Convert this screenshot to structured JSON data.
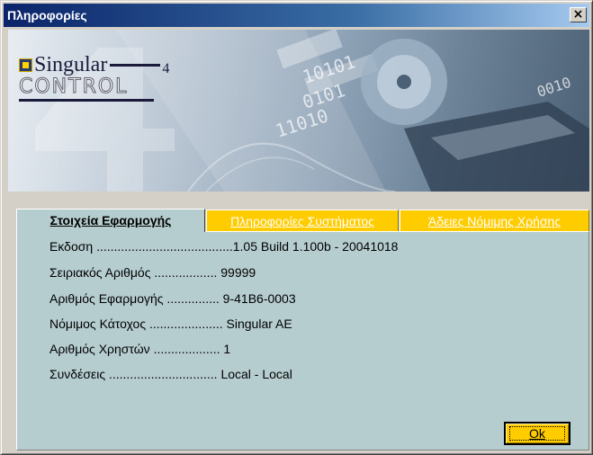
{
  "window": {
    "title": "Πληροφορίες",
    "close_glyph": "×"
  },
  "banner": {
    "logo_singular": "Singular",
    "logo_version": "4",
    "logo_control": "CONTROL",
    "digits": [
      "10101",
      "0101",
      "11010",
      "0010"
    ]
  },
  "tabs": [
    {
      "label": "Στοιχεία Εφαρμογής",
      "active": true
    },
    {
      "label": "Πληροφορίες Συστήματος",
      "active": false
    },
    {
      "label": "Άδειες Νόμιμης Χρήσης",
      "active": false
    }
  ],
  "info": [
    {
      "text": "Εκδοση .......................................1.05    Build  1.100b - 20041018"
    },
    {
      "text": "Σειριακός Αριθμός .................. 99999"
    },
    {
      "text": "Αριθμός Εφαρμογής ............... 9-41B6-0003"
    },
    {
      "text": "Νόμιμος Κάτοχος ..................... Singular AE"
    },
    {
      "text": "Αριθμός Χρηστών ................... 1"
    },
    {
      "text": "Συνδέσεις ............................... Local - Local"
    }
  ],
  "ok_button": {
    "label": "Ok"
  },
  "colors": {
    "panel": "#b6cdd0",
    "tab_inactive": "#ffcc00",
    "titlebar": "#0a246a"
  }
}
